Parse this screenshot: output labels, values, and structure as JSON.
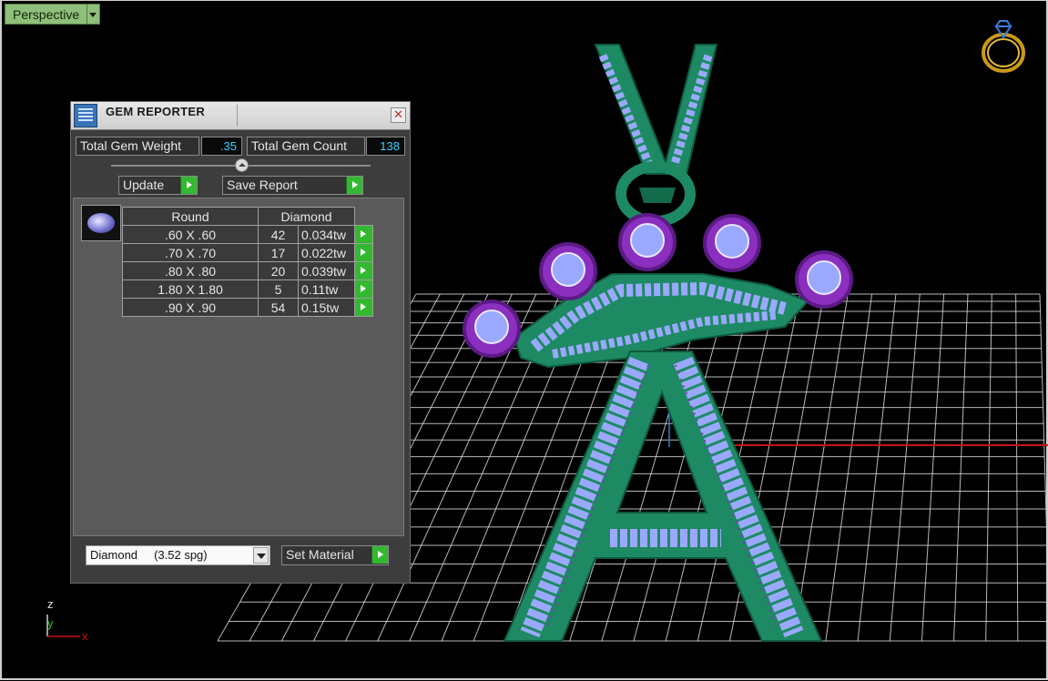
{
  "viewport": {
    "view_label": "Perspective",
    "axes": {
      "z": "z",
      "y": "y",
      "x": "x"
    }
  },
  "gem_reporter": {
    "title": "GEM REPORTER",
    "close_glyph": "✕",
    "total_gem_weight_label": "Total Gem Weight",
    "total_gem_weight_value": ".35",
    "total_gem_count_label": "Total Gem Count",
    "total_gem_count_value": "138",
    "update_label": "Update",
    "save_report_label": "Save Report",
    "table": {
      "headers": [
        "Round",
        "Diamond"
      ],
      "rows": [
        {
          "size": ".60 X .60",
          "count": "42",
          "weight": "0.034tw"
        },
        {
          "size": ".70 X .70",
          "count": "17",
          "weight": "0.022tw"
        },
        {
          "size": ".80 X .80",
          "count": "20",
          "weight": "0.039tw"
        },
        {
          "size": "1.80 X 1.80",
          "count": "5",
          "weight": "0.11tw"
        },
        {
          "size": ".90 X .90",
          "count": "54",
          "weight": "0.15tw"
        }
      ]
    },
    "material_select_value": "Diamond     (3.52 spg)",
    "set_material_label": "Set Material"
  },
  "colors": {
    "metal": "#1d8a63",
    "gem_fill": "#9aa9ff",
    "prong": "#8a2fbf",
    "grid": "#d8d8d8",
    "x_axis": "#cc1111",
    "go_button": "#33b832",
    "value_text": "#3ed0ff",
    "view_label_bg": "#8fbf7a"
  }
}
